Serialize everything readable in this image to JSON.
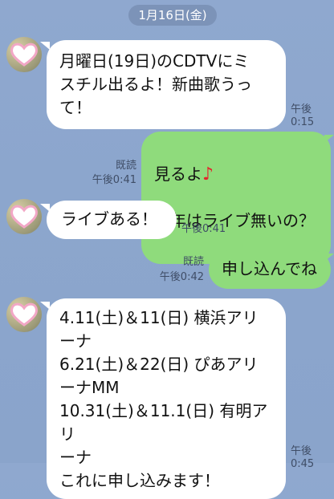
{
  "chat": {
    "date": "1月16日(金)",
    "messages": [
      {
        "from": "them",
        "text": "月曜日(19日)のCDTVにミ\nスチル出るよ！新曲歌うっ\nて！",
        "time": "午後0:15"
      },
      {
        "from": "me",
        "line1": "見るよ",
        "note": "♪",
        "line2": "今年はライブ無いの？",
        "read": "既読",
        "time": "午後0:41"
      },
      {
        "from": "them",
        "text": "ライブある！",
        "time": "午後0:41"
      },
      {
        "from": "me",
        "text": "申し込んでね",
        "read": "既読",
        "time": "午後0:42"
      },
      {
        "from": "them",
        "text": "4.11(土)＆11(日) 横浜アリ\nーナ\n6.21(土)＆22(日) ぴあアリ\nーナMM\n10.31(土)＆11.1(日) 有明アリ\nーナ\nこれに申し込みます！",
        "time": "午後0:45"
      }
    ]
  },
  "colors": {
    "background": "#8ca6cd",
    "incoming_bubble": "#ffffff",
    "outgoing_bubble": "#8fdb7c",
    "accent_note": "#e3262d"
  },
  "icons": {
    "avatar": "heart-avatar-icon"
  }
}
